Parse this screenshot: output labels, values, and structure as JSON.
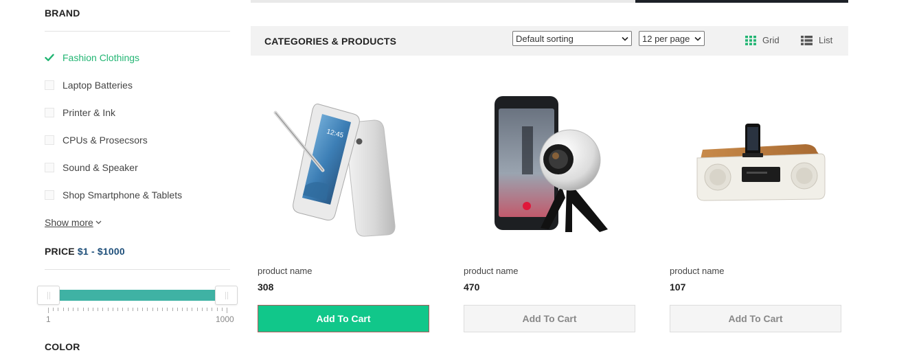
{
  "sidebar": {
    "brand_title": "BRAND",
    "brands": [
      {
        "label": "Fashion Clothings",
        "checked": true
      },
      {
        "label": "Laptop Batteries",
        "checked": false
      },
      {
        "label": "Printer & Ink",
        "checked": false
      },
      {
        "label": "CPUs & Prosecsors",
        "checked": false
      },
      {
        "label": "Sound & Speaker",
        "checked": false
      },
      {
        "label": "Shop Smartphone & Tablets",
        "checked": false
      }
    ],
    "show_more": "Show more",
    "price_title": "PRICE",
    "price_range": "$1 - $1000",
    "price_slider": {
      "min": 1,
      "max": 1000,
      "low": 1,
      "high": 1000,
      "min_label": "1",
      "max_label": "1000"
    },
    "color_title": "COLOR"
  },
  "toolbar": {
    "title": "CATEGORIES & PRODUCTS",
    "sort_value": "Default sorting",
    "per_page_value": "12 per page",
    "grid_label": "Grid",
    "list_label": "List",
    "grid_icon": "grid-icon",
    "list_icon": "list-icon"
  },
  "products": [
    {
      "name": "product name",
      "price": "308",
      "cart_label": "Add To Cart",
      "image": "smartphone-with-stylus",
      "highlighted": true
    },
    {
      "name": "product name",
      "price": "470",
      "cart_label": "Add To Cart",
      "image": "phone-with-360-camera",
      "highlighted": false
    },
    {
      "name": "product name",
      "price": "107",
      "cart_label": "Add To Cart",
      "image": "speaker-dock",
      "highlighted": false
    }
  ],
  "colors": {
    "accent": "#22b573",
    "button": "#11c78a",
    "slider": "#3fb2a4",
    "price_range": "#1e4f7a"
  }
}
